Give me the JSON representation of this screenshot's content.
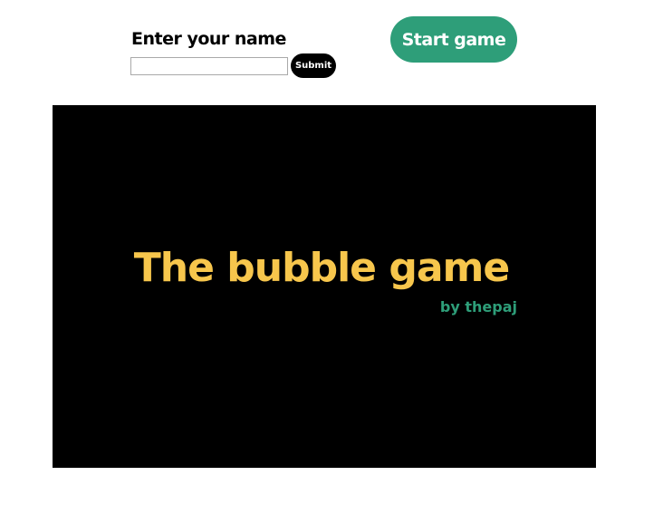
{
  "name_form": {
    "label": "Enter your name",
    "input_value": "",
    "submit_label": "Submit"
  },
  "start_button": {
    "label": "Start game"
  },
  "game_screen": {
    "title": "The bubble game",
    "byline": "by thepaj"
  },
  "colors": {
    "accent_green": "#2e9e79",
    "title_yellow": "#f7c64c",
    "canvas_background": "#000000"
  }
}
